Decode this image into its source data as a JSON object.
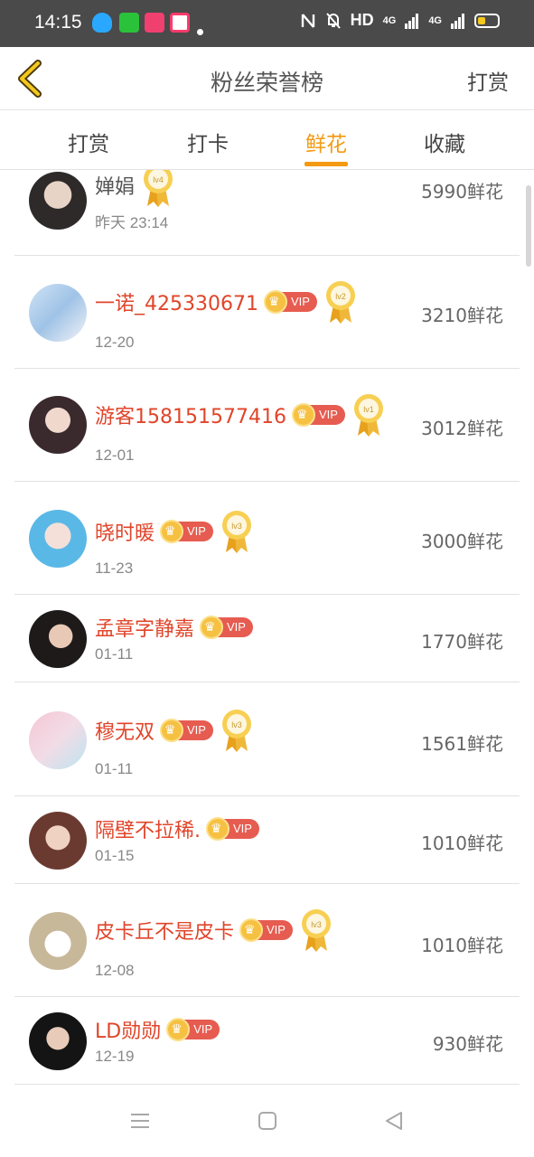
{
  "status_bar": {
    "time": "14:15",
    "right_text": "HD",
    "network_1": "4G",
    "network_2": "4G"
  },
  "header": {
    "title": "粉丝荣誉榜",
    "back_icon": "chevron-left-icon",
    "action_label": "打赏"
  },
  "tabs": [
    {
      "label": "打赏",
      "active": false
    },
    {
      "label": "打卡",
      "active": false
    },
    {
      "label": "鲜花",
      "active": true
    },
    {
      "label": "收藏",
      "active": false
    }
  ],
  "colors": {
    "accent": "#f39a12",
    "username_vip": "#e0452a",
    "vip_badge": "#e65c50",
    "status_bar": "#4a4a4a"
  },
  "rows": [
    {
      "name": "婵娟",
      "vip": false,
      "vip_label": "",
      "level": "lv4",
      "date": "昨天 23:14",
      "amount": "5990鲜花"
    },
    {
      "name": "一诺_425330671",
      "vip": true,
      "vip_label": "VIP",
      "level": "lv2",
      "date": "12-20",
      "amount": "3210鲜花"
    },
    {
      "name": "游客158151577416",
      "vip": true,
      "vip_label": "VIP",
      "level": "lv1",
      "date": "12-01",
      "amount": "3012鲜花"
    },
    {
      "name": "晓时暖",
      "vip": true,
      "vip_label": "VIP",
      "level": "lv3",
      "date": "11-23",
      "amount": "3000鲜花"
    },
    {
      "name": "孟章字静嘉",
      "vip": true,
      "vip_label": "VIP",
      "level": "",
      "date": "01-11",
      "amount": "1770鲜花"
    },
    {
      "name": "穆无双",
      "vip": true,
      "vip_label": "VIP",
      "level": "lv3",
      "date": "01-11",
      "amount": "1561鲜花"
    },
    {
      "name": "隔壁不拉稀.",
      "vip": true,
      "vip_label": "VIP",
      "level": "",
      "date": "01-15",
      "amount": "1010鲜花"
    },
    {
      "name": "皮卡丘不是皮卡",
      "vip": true,
      "vip_label": "VIP",
      "level": "lv3",
      "date": "12-08",
      "amount": "1010鲜花"
    },
    {
      "name": "LD勋勋",
      "vip": true,
      "vip_label": "VIP",
      "level": "",
      "date": "12-19",
      "amount": "930鲜花"
    }
  ],
  "nav": {
    "menu_icon": "menu-icon",
    "home_icon": "home-square-icon",
    "back_icon": "back-triangle-icon"
  }
}
